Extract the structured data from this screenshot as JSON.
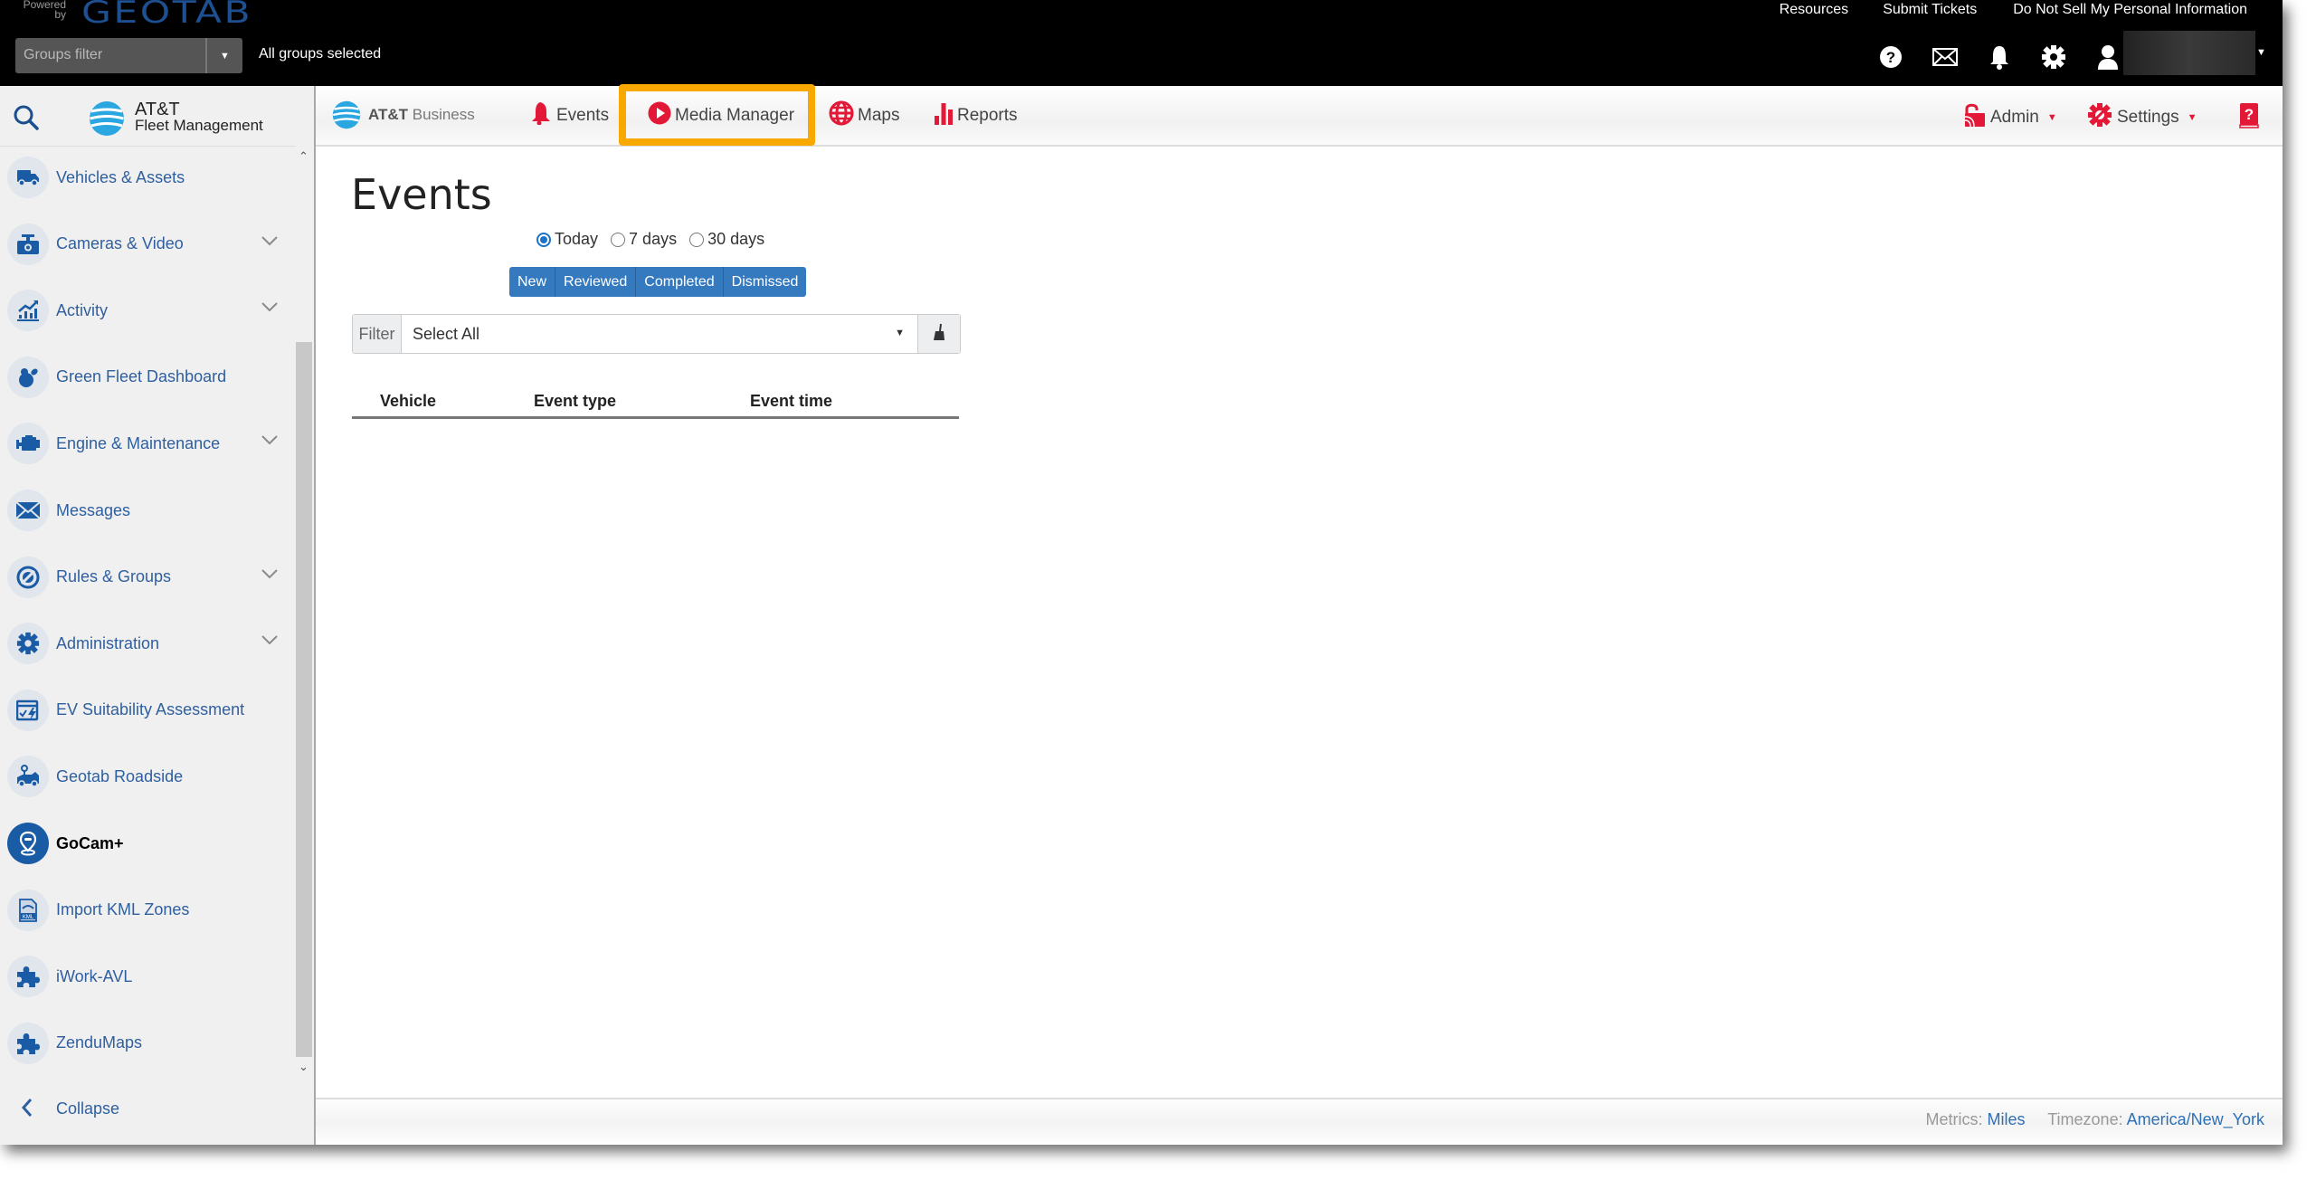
{
  "topbar": {
    "powered_by": "Powered by",
    "brand": "GEOTAB",
    "groups_filter_placeholder": "Groups filter",
    "groups_status": "All groups selected",
    "links": [
      "Resources",
      "Submit Tickets",
      "Do Not Sell My Personal Information"
    ],
    "icons": [
      "help-icon",
      "mail-icon",
      "bell-icon",
      "gear-icon",
      "user-icon"
    ]
  },
  "sidebar": {
    "brand_line1": "AT&T",
    "brand_line2": "Fleet Management",
    "items": [
      {
        "label": "Vehicles & Assets",
        "icon": "truck-icon",
        "expandable": false
      },
      {
        "label": "Cameras & Video",
        "icon": "camera-icon",
        "expandable": true
      },
      {
        "label": "Activity",
        "icon": "activity-chart-icon",
        "expandable": true
      },
      {
        "label": "Green Fleet Dashboard",
        "icon": "green-fleet-icon",
        "expandable": false
      },
      {
        "label": "Engine & Maintenance",
        "icon": "engine-icon",
        "expandable": true
      },
      {
        "label": "Messages",
        "icon": "envelope-icon",
        "expandable": false
      },
      {
        "label": "Rules & Groups",
        "icon": "rules-icon",
        "expandable": true
      },
      {
        "label": "Administration",
        "icon": "gear-icon",
        "expandable": true
      },
      {
        "label": "EV Suitability Assessment",
        "icon": "ev-assessment-icon",
        "expandable": false
      },
      {
        "label": "Geotab Roadside",
        "icon": "tow-truck-icon",
        "expandable": false
      },
      {
        "label": "GoCam+",
        "icon": "location-pin-icon",
        "expandable": false,
        "active": true
      },
      {
        "label": "Import KML Zones",
        "icon": "kml-file-icon",
        "expandable": false
      },
      {
        "label": "iWork-AVL",
        "icon": "puzzle-icon",
        "expandable": false
      },
      {
        "label": "ZenduMaps",
        "icon": "puzzle-icon",
        "expandable": false
      }
    ],
    "collapse_label": "Collapse"
  },
  "navbar": {
    "brand_bold": "AT&T",
    "brand_light": " Business",
    "tabs": [
      {
        "label": "Events",
        "icon": "bell-icon"
      },
      {
        "label": "Media Manager",
        "icon": "play-icon",
        "highlighted": true
      },
      {
        "label": "Maps",
        "icon": "globe-icon"
      },
      {
        "label": "Reports",
        "icon": "bar-chart-icon"
      }
    ],
    "admin_label": "Admin",
    "settings_label": "Settings",
    "accent_color": "#e31837",
    "highlight_color": "#f9a800"
  },
  "main": {
    "title": "Events",
    "time_range": {
      "options": [
        "Today",
        "7 days",
        "30 days"
      ],
      "selected": "Today"
    },
    "state_tabs": [
      "New",
      "Reviewed",
      "Completed",
      "Dismissed"
    ],
    "filter": {
      "label": "Filter",
      "value": "Select All"
    },
    "table": {
      "columns": [
        "Vehicle",
        "Event type",
        "Event time"
      ],
      "rows": []
    }
  },
  "footer": {
    "metrics_label": "Metrics: ",
    "metrics_value": "Miles",
    "timezone_label": "Timezone: ",
    "timezone_value": "America/New_York"
  }
}
